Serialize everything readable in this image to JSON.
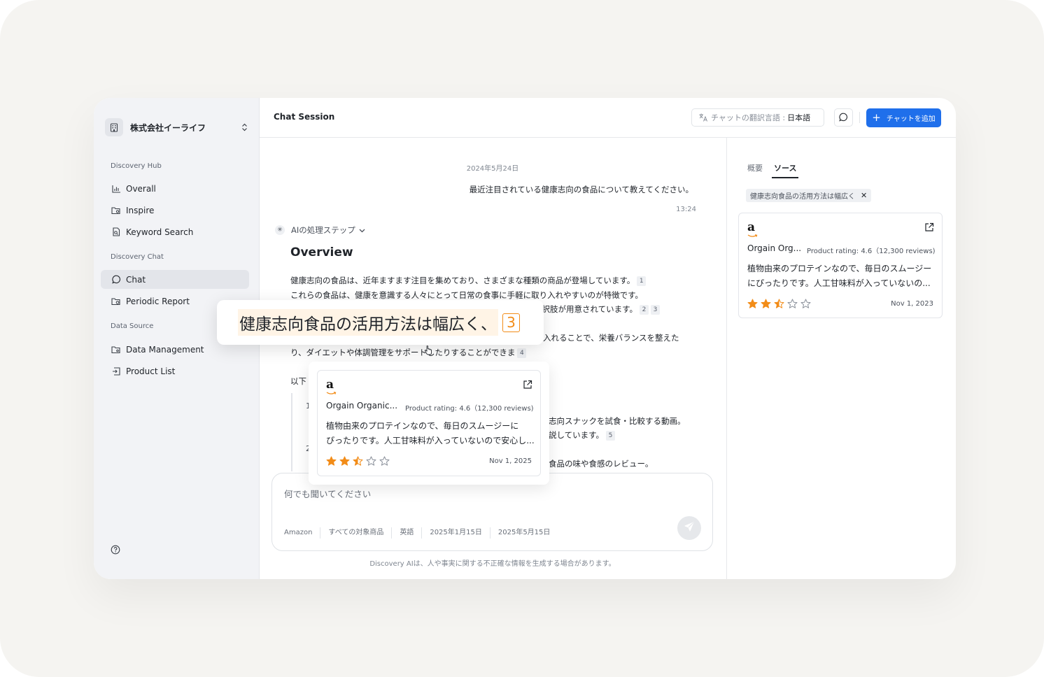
{
  "sidebar": {
    "org_name": "株式会社イーライフ",
    "sections": [
      {
        "label": "Discovery Hub",
        "items": [
          {
            "label": "Overall"
          },
          {
            "label": "Inspire"
          },
          {
            "label": "Keyword Search"
          }
        ]
      },
      {
        "label": "Discovery Chat",
        "items": [
          {
            "label": "Chat",
            "active": true
          },
          {
            "label": "Periodic Report"
          }
        ]
      },
      {
        "label": "Data Source",
        "items": [
          {
            "label": "Data Management"
          },
          {
            "label": "Product List"
          }
        ]
      }
    ]
  },
  "header": {
    "title": "Chat Session",
    "translate_label": "チャットの翻訳言語 :",
    "translate_value": "日本語",
    "add_chat_label": "チャットを追加"
  },
  "chat": {
    "date": "2024年5月24日",
    "user_message": "最近注目されている健康志向の食品について教えてください。",
    "user_time": "13:24",
    "ai_steps_label": "AIの処理ステップ",
    "overview_title": "Overview",
    "paragraph_lines": [
      {
        "text": "健康志向の食品は、近年ますます注目を集めており、さまざまな種類の商品が登場しています。",
        "cites": [
          "1"
        ]
      },
      {
        "text": "これらの食品は、健康を意識する人々にとって日常の食事に手軽に取り入れやすいのが特徴です。",
        "cites": []
      },
      {
        "text": "選択肢が用意されています。",
        "cites": [
          "2",
          "3"
        ]
      },
      {
        "text": "入れることで、栄養バランスを整えた",
        "cites": []
      },
      {
        "text": "り、ダイエットや体調管理をサポートしたりすることができま",
        "cites": [
          "4"
        ]
      },
      {
        "text": "以下",
        "cites": []
      }
    ],
    "list_numbers": [
      "1",
      "2"
    ],
    "list_lines": [
      {
        "text": "志向スナックを試食・比較する動画。",
        "cites": []
      },
      {
        "text": "説しています。",
        "cites": [
          "5"
        ]
      },
      {
        "text": "食品の味や食感のレビュー。",
        "cites": []
      }
    ],
    "composer_placeholder": "何でも聞いてください",
    "filters": [
      "Amazon",
      "すべての対象商品",
      "英語",
      "2025年1月15日",
      "2025年5月15日"
    ],
    "disclaimer": "Discovery AIは、人や事実に関する不正確な情報を生成する場合があります。"
  },
  "callout": {
    "text": "健康志向食品の活用方法は幅広く、",
    "cite": "3"
  },
  "popup_card": {
    "name": "Orgain Organic...",
    "rating_text": "Product rating: 4.6（12,300 reviews)",
    "desc_lines": [
      "植物由来のプロテインなので、毎日のスムージーに",
      "ぴったりです。人工甘味料が入っていないので安心し..."
    ],
    "rating": 2.5,
    "date": "Nov 1, 2025"
  },
  "panel": {
    "tabs": [
      {
        "label": "概要"
      },
      {
        "label": "ソース",
        "active": true
      }
    ],
    "chip_label": "健康志向食品の活用方法は幅広く",
    "card": {
      "name": "Orgain Org...",
      "rating_text": "Product rating: 4.6（12,300 reviews)",
      "desc_lines": [
        "植物由来のプロテインなので、毎日のスムージー",
        "にぴったりです。人工甘味料が入っていないの..."
      ],
      "rating": 2.5,
      "date": "Nov 1, 2023"
    }
  },
  "colors": {
    "accent": "#1f6feb",
    "star": "#f28c18",
    "highlight": "#fff4e6"
  }
}
